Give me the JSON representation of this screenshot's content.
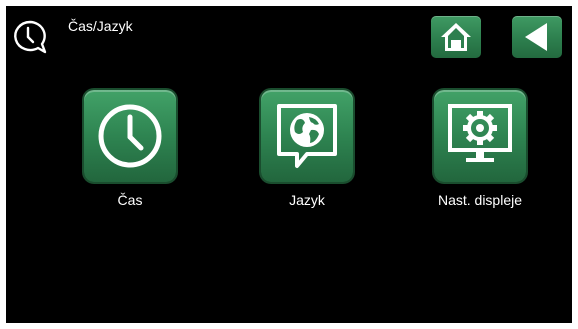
{
  "header": {
    "title": "Čas/Jazyk",
    "icon": "clock-speech-bubble-icon"
  },
  "nav": {
    "home_icon": "home-icon",
    "back_icon": "back-arrow-icon"
  },
  "tiles": [
    {
      "label": "Čas",
      "icon": "clock-icon"
    },
    {
      "label": "Jazyk",
      "icon": "globe-speech-bubble-icon"
    },
    {
      "label": "Nast. displeje",
      "icon": "monitor-gear-icon"
    }
  ],
  "colors": {
    "background": "#000000",
    "tile_green": "#2e8451",
    "text": "#ffffff"
  }
}
